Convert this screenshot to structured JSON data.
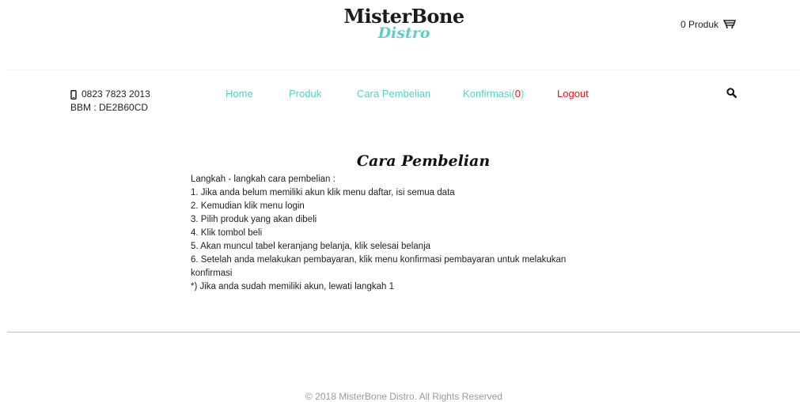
{
  "brand": {
    "main": "MisterBone",
    "sub": "Distro"
  },
  "cart": {
    "label": "0 Produk",
    "icon": "cart-icon"
  },
  "contact": {
    "phone": "0823 7823 2013",
    "bbm": "BBM : DE2B60CD",
    "icon": "phone-icon"
  },
  "nav": {
    "home": "Home",
    "produk": "Produk",
    "cara": "Cara Pembelian",
    "konfirmasi": "Konfirmasi(",
    "konfirmasi_count": "0",
    "konfirmasi_close": ")",
    "logout": "Logout"
  },
  "search": {
    "icon": "search-icon"
  },
  "content": {
    "title": "Cara Pembelian",
    "lines": [
      "Langkah - langkah cara pembelian :",
      "1. Jika anda belum memiliki akun klik menu daftar, isi semua data",
      "2. Kemudian klik menu login",
      "3. Pilih produk yang akan dibeli",
      "4. Klik tombol beli",
      "5. Akan muncul tabel keranjang belanja, klik selesai belanja",
      "6. Setelah anda melakukan pembayaran, klik menu konfirmasi pembayaran untuk melakukan",
      "konfirmasi",
      "*) Jika anda sudah memiliki akun, lewati langkah 1"
    ]
  },
  "footer": {
    "text": "© 2018 MisterBone Distro. All Rights Reserved"
  },
  "colors": {
    "accent": "#5dcfc4",
    "logout": "#e0191f",
    "text": "#222222",
    "footer": "#999999"
  }
}
